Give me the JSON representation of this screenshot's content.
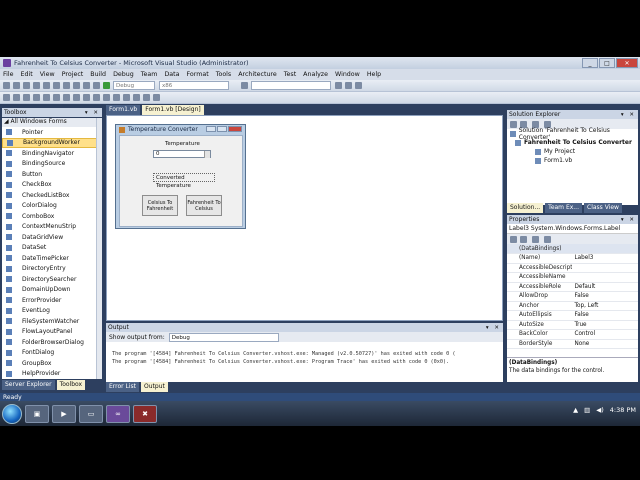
{
  "window": {
    "title": "Fahrenheit To Celsius Converter - Microsoft Visual Studio (Administrator)"
  },
  "menu": [
    "File",
    "Edit",
    "View",
    "Project",
    "Build",
    "Debug",
    "Team",
    "Data",
    "Format",
    "Tools",
    "Architecture",
    "Test",
    "Analyze",
    "Window",
    "Help"
  ],
  "toolbar": {
    "config": "Debug",
    "platform": "x86"
  },
  "toolbox": {
    "title": "Toolbox",
    "group": "All Windows Forms",
    "items": [
      "Pointer",
      "BackgroundWorker",
      "BindingNavigator",
      "BindingSource",
      "Button",
      "CheckBox",
      "CheckedListBox",
      "ColorDialog",
      "ComboBox",
      "ContextMenuStrip",
      "DataGridView",
      "DataSet",
      "DateTimePicker",
      "DirectoryEntry",
      "DirectorySearcher",
      "DomainUpDown",
      "ErrorProvider",
      "EventLog",
      "FileSystemWatcher",
      "FlowLayoutPanel",
      "FolderBrowserDialog",
      "FontDialog",
      "GroupBox",
      "HelpProvider"
    ],
    "selected_index": 1
  },
  "doc_tabs": [
    "Form1.vb",
    "Form1.vb [Design]"
  ],
  "form": {
    "title": "Temperature Converter",
    "temp_label": "Temperature",
    "numeric_value": "0",
    "converted_label": "Converted Temperature",
    "btn_c2f": "Celsius To Fahrenheit",
    "btn_f2c": "Fahrenheit To Celsius"
  },
  "output": {
    "title": "Output",
    "show_from_label": "Show output from:",
    "show_from_value": "Debug",
    "lines": [
      "The program '[4584] Fahrenheit To Celsius Converter.vshost.exe: Managed (v2.0.50727)' has exited with code 0 (",
      "The program '[4584] Fahrenheit To Celsius Converter.vshost.exe: Program Trace' has exited with code 0 (0x0)."
    ]
  },
  "solution": {
    "title": "Solution Explorer",
    "items": [
      "Solution 'Fahrenheit To Celsius Converter'",
      "Fahrenheit To Celsius Converter",
      "My Project",
      "Form1.vb"
    ],
    "tabs": [
      "Solution...",
      "Team Ex...",
      "Class View"
    ]
  },
  "properties": {
    "title": "Properties",
    "object": "Label3 System.Windows.Forms.Label",
    "rows": [
      [
        "(DataBindings)",
        ""
      ],
      [
        "(Name)",
        "Label3"
      ],
      [
        "AccessibleDescript",
        ""
      ],
      [
        "AccessibleName",
        ""
      ],
      [
        "AccessibleRole",
        "Default"
      ],
      [
        "AllowDrop",
        "False"
      ],
      [
        "Anchor",
        "Top, Left"
      ],
      [
        "AutoEllipsis",
        "False"
      ],
      [
        "AutoSize",
        "True"
      ],
      [
        "BackColor",
        "Control"
      ],
      [
        "BorderStyle",
        "None"
      ]
    ],
    "desc_title": "(DataBindings)",
    "desc_text": "The data bindings for the control."
  },
  "bottom_tabs_left": [
    "Server Explorer",
    "Toolbox"
  ],
  "bottom_tabs_center": [
    "Error List",
    "Output"
  ],
  "status": "Ready",
  "clock": "4:38 PM"
}
